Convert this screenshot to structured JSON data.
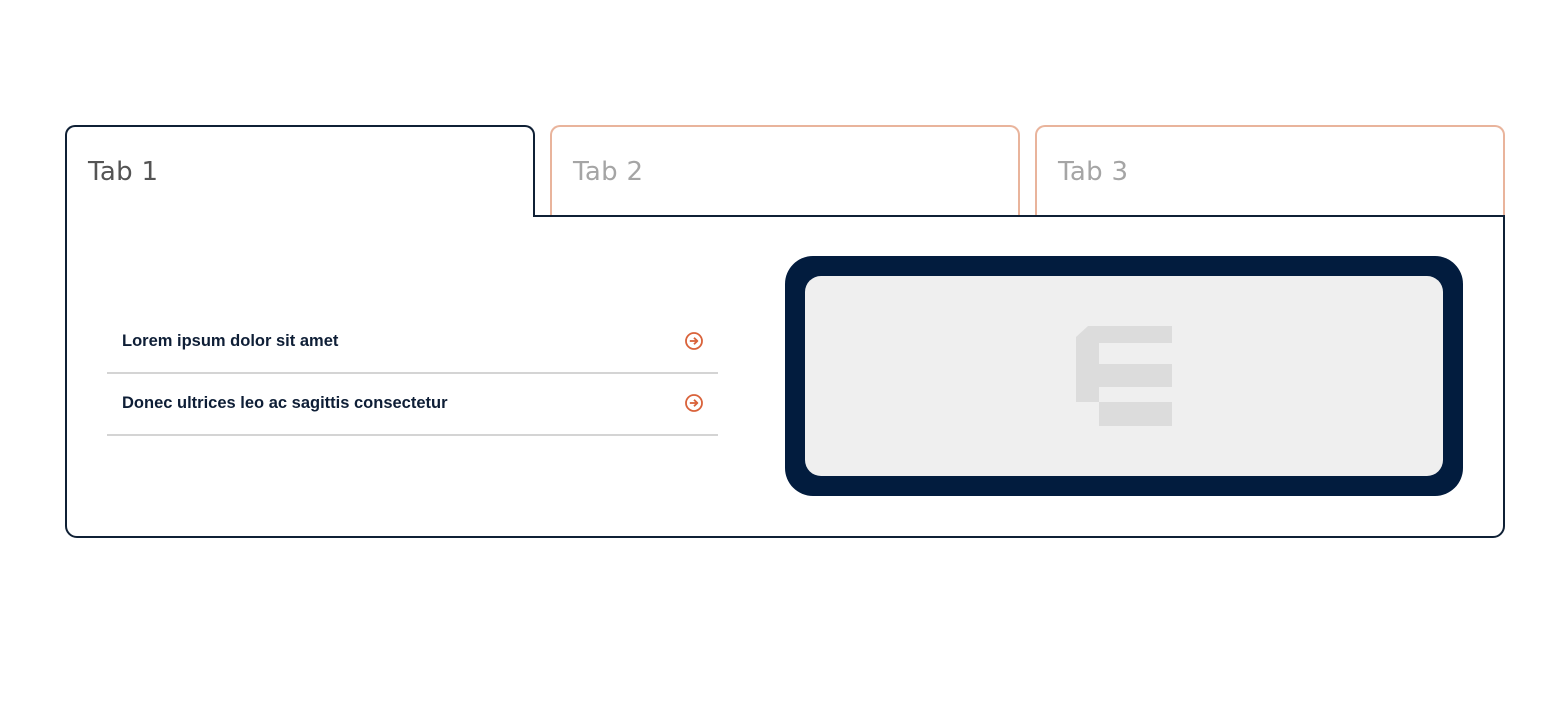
{
  "tabs": [
    {
      "label": "Tab 1",
      "active": true
    },
    {
      "label": "Tab 2",
      "active": false
    },
    {
      "label": "Tab 3",
      "active": false
    }
  ],
  "panel": {
    "links": [
      {
        "text": "Lorem ipsum dolor sit amet",
        "icon": "arrow-circle-right-icon"
      },
      {
        "text": "Donec ultrices leo ac sagittis consectetur",
        "icon": "arrow-circle-right-icon"
      }
    ],
    "image": {
      "icon": "elementor-logo-placeholder-icon"
    }
  },
  "colors": {
    "active_border": "#0f2035",
    "inactive_border": "#e9b49c",
    "accent": "#d9623a",
    "frame": "#021c3e",
    "placeholder_bg": "#efefef",
    "link_text": "#0e1e36"
  }
}
